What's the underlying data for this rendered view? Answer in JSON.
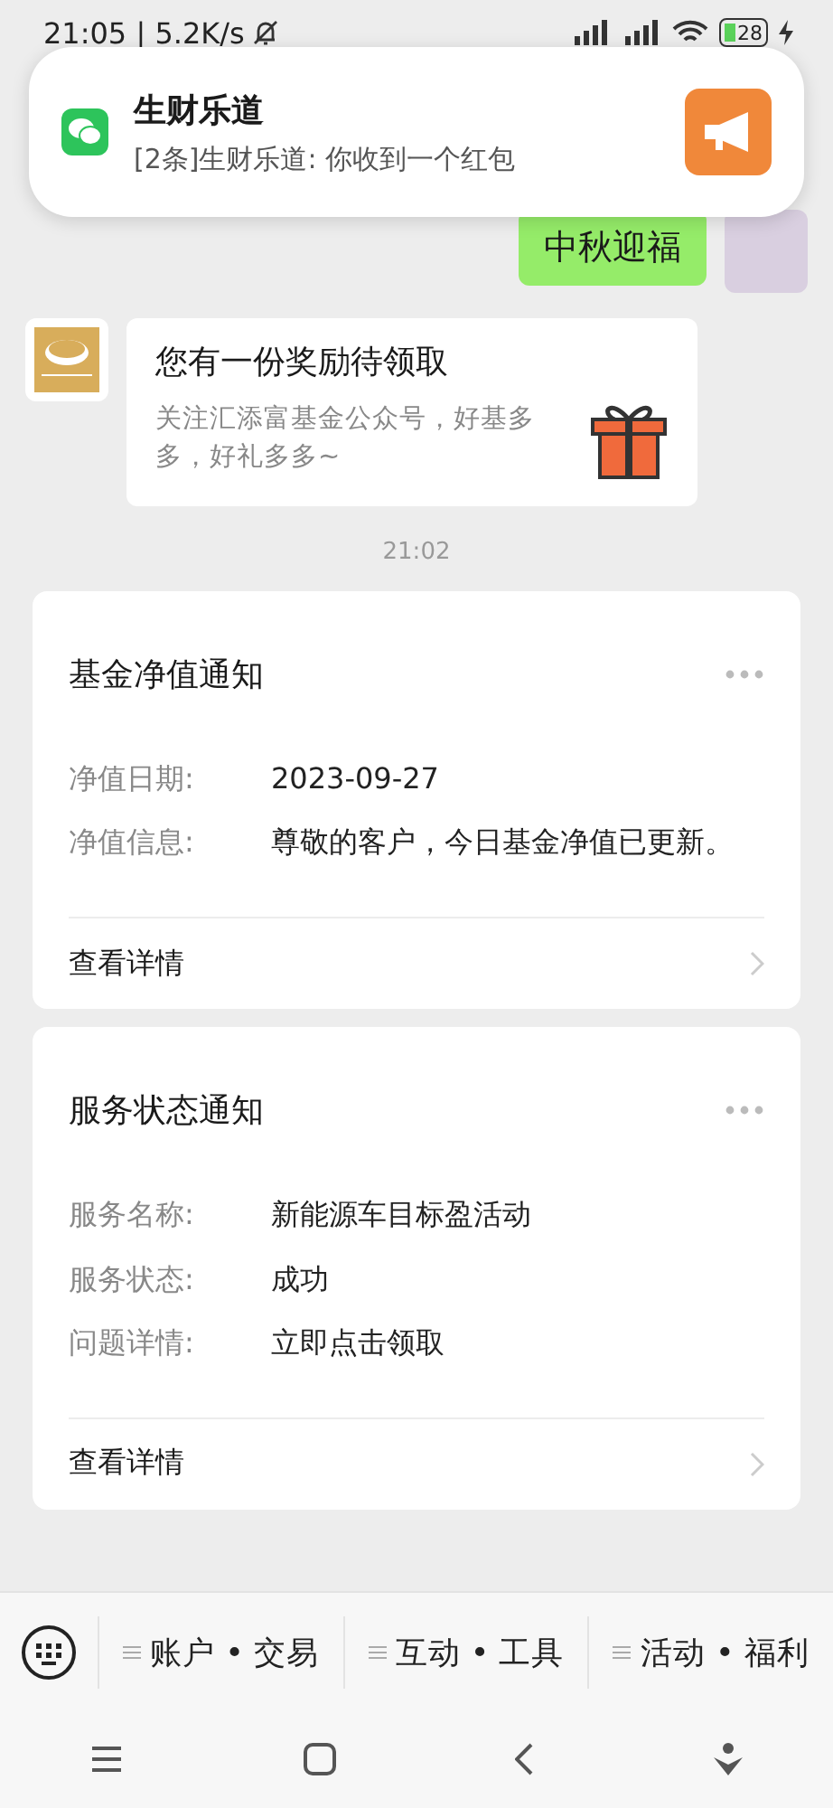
{
  "status_bar": {
    "time": "21:05",
    "separator": "|",
    "speed": "5.2K/s",
    "battery": "28"
  },
  "notification": {
    "app": "生财乐道",
    "message": "[2条]生财乐道: 你收到一个红包"
  },
  "messages": [
    {
      "kind": "text",
      "text": "中秋迎福"
    },
    {
      "kind": "promo",
      "title": "您有一份奖励待领取",
      "body": "关注汇添富基金公众号，好基多多，好礼多多~"
    }
  ],
  "timestamp": "21:02",
  "cards": [
    {
      "title": "基金净值通知",
      "fields": [
        {
          "label": "净值日期:",
          "value": "2023-09-27"
        },
        {
          "label": "净值信息:",
          "value": "尊敬的客户，今日基金净值已更新。"
        }
      ],
      "link": "查看详情"
    },
    {
      "title": "服务状态通知",
      "fields": [
        {
          "label": "服务名称:",
          "value": "新能源车目标盈活动"
        },
        {
          "label": "服务状态:",
          "value": "成功"
        },
        {
          "label": "问题详情:",
          "value": "立即点击领取"
        }
      ],
      "link": "查看详情"
    }
  ],
  "menu_tabs": [
    "账户 • 交易",
    "互动 • 工具",
    "活动 • 福利"
  ]
}
